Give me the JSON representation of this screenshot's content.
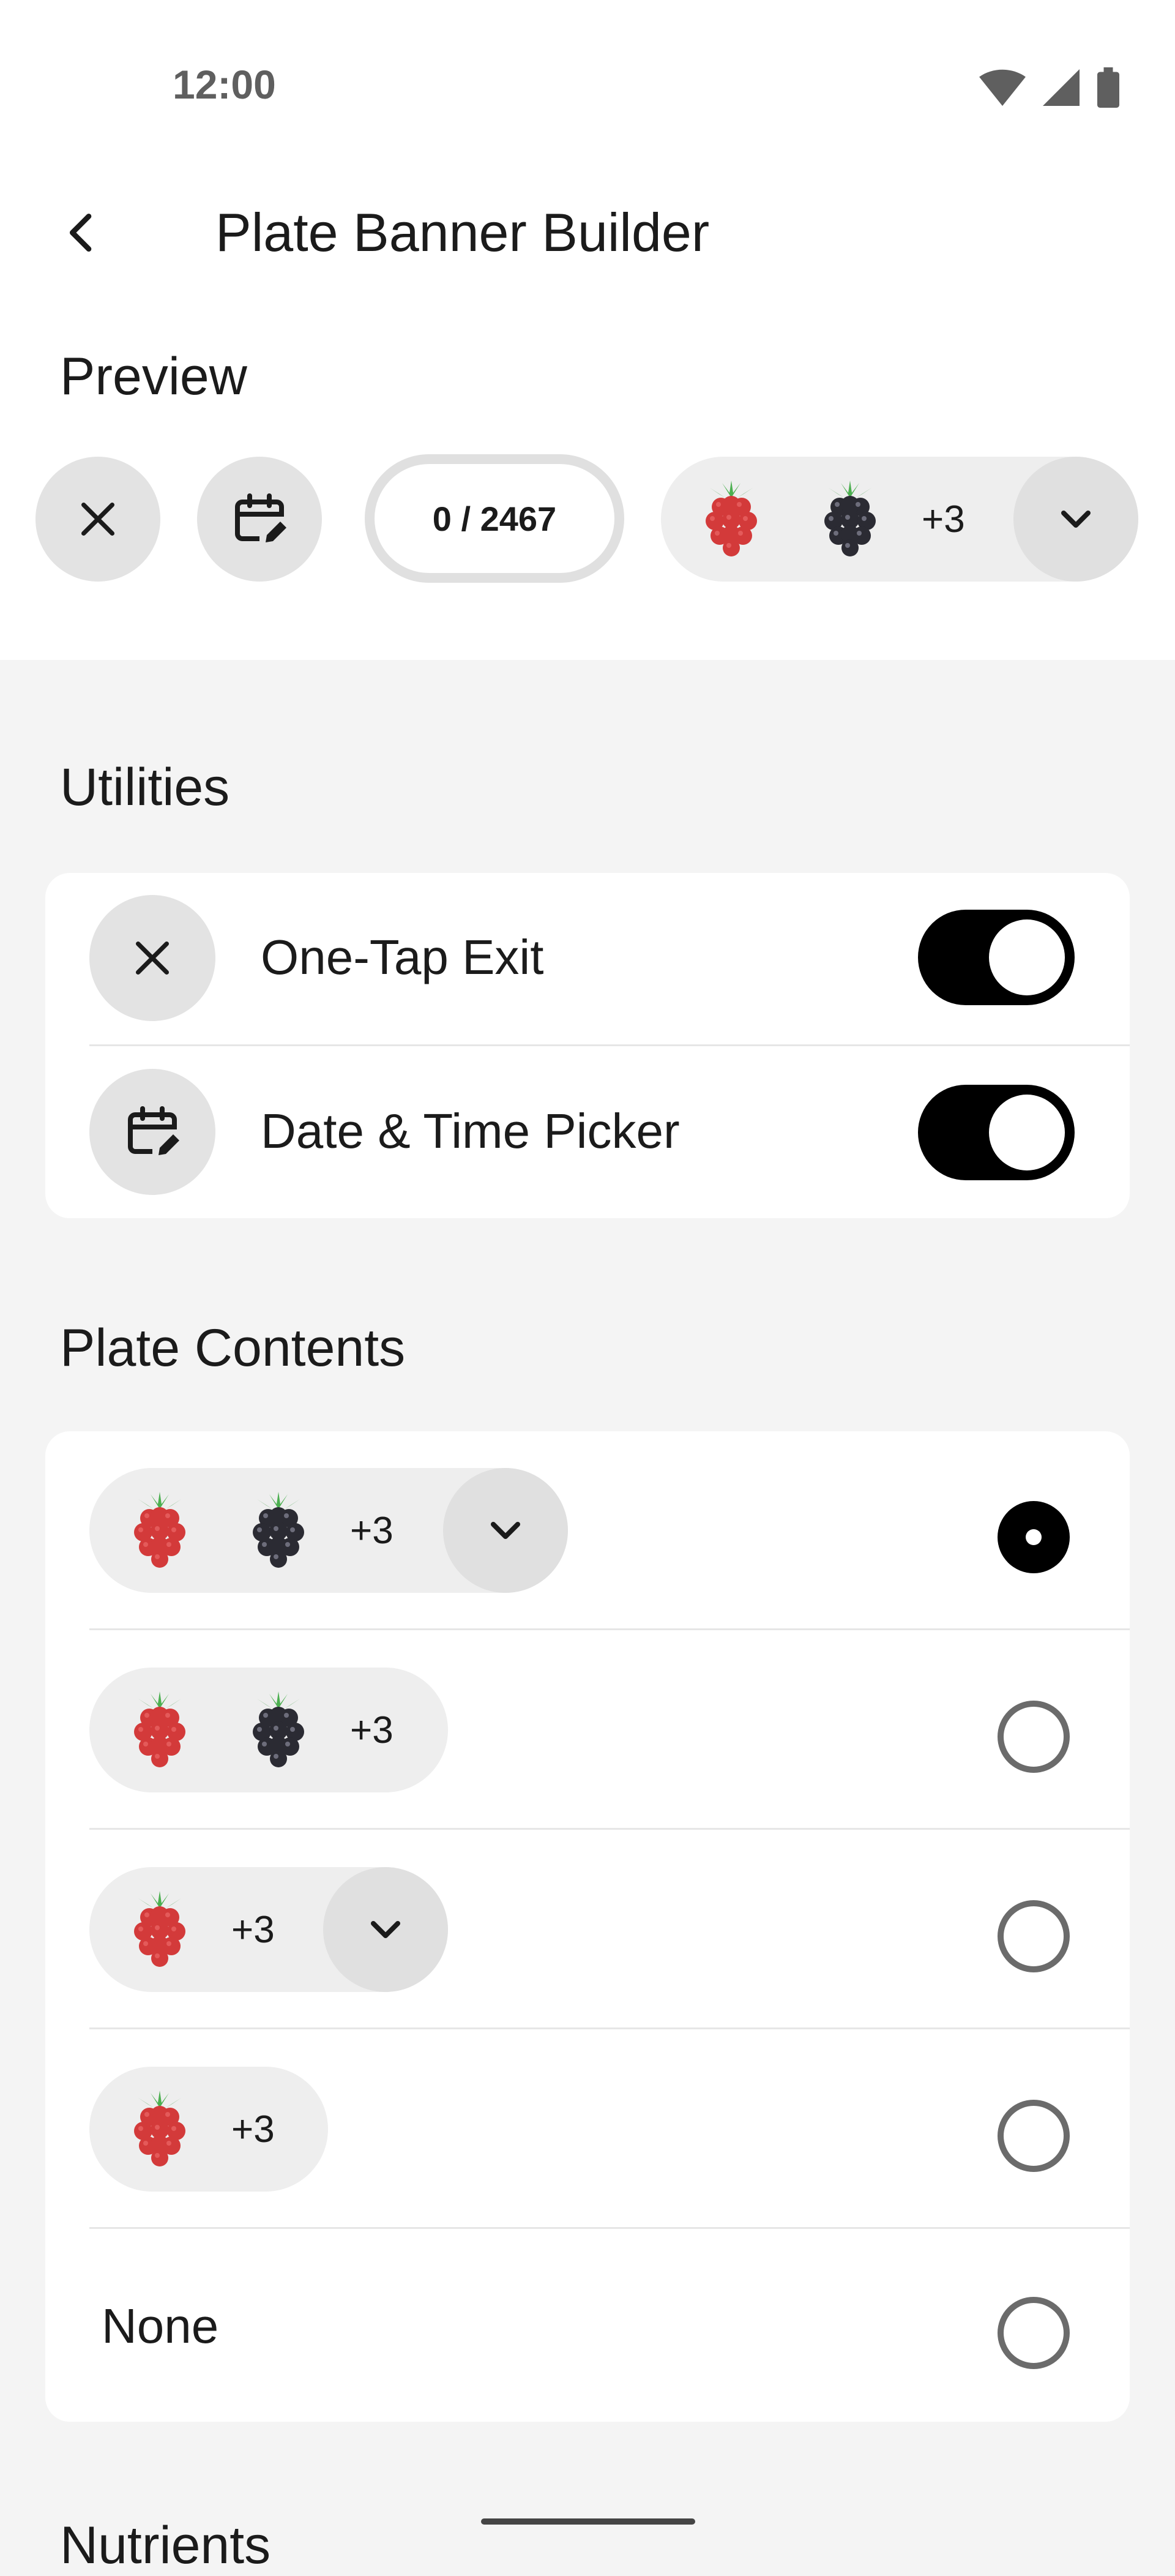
{
  "status_bar": {
    "time": "12:00",
    "icons": [
      "wifi-icon",
      "signal-icon",
      "battery-icon"
    ]
  },
  "app_bar": {
    "title": "Plate Banner Builder",
    "back_icon": "arrow-back-icon"
  },
  "preview": {
    "heading": "Preview",
    "close_icon": "close-icon",
    "calendar_icon": "calendar-edit-icon",
    "counter": "0 / 2467",
    "fruits": [
      "raspberry-icon",
      "blackberry-icon"
    ],
    "more": "+3",
    "expand_icon": "chevron-down-icon"
  },
  "utilities": {
    "heading": "Utilities",
    "items": [
      {
        "label": "One-Tap Exit",
        "icon": "close-icon",
        "enabled": true
      },
      {
        "label": "Date & Time Picker",
        "icon": "calendar-edit-icon",
        "enabled": true
      }
    ]
  },
  "plate_contents": {
    "heading": "Plate Contents",
    "options": [
      {
        "fruits": [
          "raspberry-icon",
          "blackberry-icon"
        ],
        "more": "+3",
        "expandable": true,
        "selected": true
      },
      {
        "fruits": [
          "raspberry-icon",
          "blackberry-icon"
        ],
        "more": "+3",
        "expandable": false,
        "selected": false
      },
      {
        "fruits": [
          "raspberry-icon"
        ],
        "more": "+3",
        "expandable": true,
        "selected": false
      },
      {
        "fruits": [
          "raspberry-icon"
        ],
        "more": "+3",
        "expandable": false,
        "selected": false
      },
      {
        "label": "None",
        "selected": false
      }
    ]
  },
  "nutrients": {
    "heading": "Nutrients"
  },
  "colors": {
    "toggle_on": "#000000",
    "surface": "#ffffff",
    "background": "#f4f4f4",
    "chip": "#eeeeee"
  }
}
